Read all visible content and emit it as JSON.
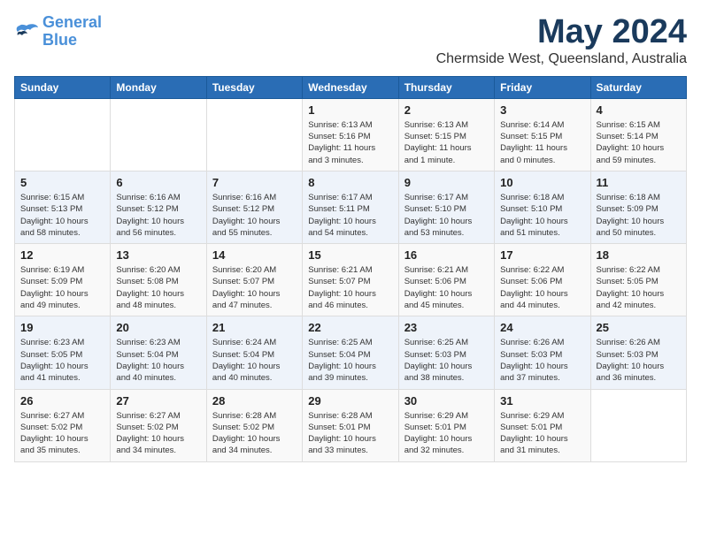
{
  "header": {
    "logo_line1": "General",
    "logo_line2": "Blue",
    "title": "May 2024",
    "subtitle": "Chermside West, Queensland, Australia"
  },
  "days_of_week": [
    "Sunday",
    "Monday",
    "Tuesday",
    "Wednesday",
    "Thursday",
    "Friday",
    "Saturday"
  ],
  "weeks": [
    [
      {
        "day": "",
        "info": ""
      },
      {
        "day": "",
        "info": ""
      },
      {
        "day": "",
        "info": ""
      },
      {
        "day": "1",
        "info": "Sunrise: 6:13 AM\nSunset: 5:16 PM\nDaylight: 11 hours\nand 3 minutes."
      },
      {
        "day": "2",
        "info": "Sunrise: 6:13 AM\nSunset: 5:15 PM\nDaylight: 11 hours\nand 1 minute."
      },
      {
        "day": "3",
        "info": "Sunrise: 6:14 AM\nSunset: 5:15 PM\nDaylight: 11 hours\nand 0 minutes."
      },
      {
        "day": "4",
        "info": "Sunrise: 6:15 AM\nSunset: 5:14 PM\nDaylight: 10 hours\nand 59 minutes."
      }
    ],
    [
      {
        "day": "5",
        "info": "Sunrise: 6:15 AM\nSunset: 5:13 PM\nDaylight: 10 hours\nand 58 minutes."
      },
      {
        "day": "6",
        "info": "Sunrise: 6:16 AM\nSunset: 5:12 PM\nDaylight: 10 hours\nand 56 minutes."
      },
      {
        "day": "7",
        "info": "Sunrise: 6:16 AM\nSunset: 5:12 PM\nDaylight: 10 hours\nand 55 minutes."
      },
      {
        "day": "8",
        "info": "Sunrise: 6:17 AM\nSunset: 5:11 PM\nDaylight: 10 hours\nand 54 minutes."
      },
      {
        "day": "9",
        "info": "Sunrise: 6:17 AM\nSunset: 5:10 PM\nDaylight: 10 hours\nand 53 minutes."
      },
      {
        "day": "10",
        "info": "Sunrise: 6:18 AM\nSunset: 5:10 PM\nDaylight: 10 hours\nand 51 minutes."
      },
      {
        "day": "11",
        "info": "Sunrise: 6:18 AM\nSunset: 5:09 PM\nDaylight: 10 hours\nand 50 minutes."
      }
    ],
    [
      {
        "day": "12",
        "info": "Sunrise: 6:19 AM\nSunset: 5:09 PM\nDaylight: 10 hours\nand 49 minutes."
      },
      {
        "day": "13",
        "info": "Sunrise: 6:20 AM\nSunset: 5:08 PM\nDaylight: 10 hours\nand 48 minutes."
      },
      {
        "day": "14",
        "info": "Sunrise: 6:20 AM\nSunset: 5:07 PM\nDaylight: 10 hours\nand 47 minutes."
      },
      {
        "day": "15",
        "info": "Sunrise: 6:21 AM\nSunset: 5:07 PM\nDaylight: 10 hours\nand 46 minutes."
      },
      {
        "day": "16",
        "info": "Sunrise: 6:21 AM\nSunset: 5:06 PM\nDaylight: 10 hours\nand 45 minutes."
      },
      {
        "day": "17",
        "info": "Sunrise: 6:22 AM\nSunset: 5:06 PM\nDaylight: 10 hours\nand 44 minutes."
      },
      {
        "day": "18",
        "info": "Sunrise: 6:22 AM\nSunset: 5:05 PM\nDaylight: 10 hours\nand 42 minutes."
      }
    ],
    [
      {
        "day": "19",
        "info": "Sunrise: 6:23 AM\nSunset: 5:05 PM\nDaylight: 10 hours\nand 41 minutes."
      },
      {
        "day": "20",
        "info": "Sunrise: 6:23 AM\nSunset: 5:04 PM\nDaylight: 10 hours\nand 40 minutes."
      },
      {
        "day": "21",
        "info": "Sunrise: 6:24 AM\nSunset: 5:04 PM\nDaylight: 10 hours\nand 40 minutes."
      },
      {
        "day": "22",
        "info": "Sunrise: 6:25 AM\nSunset: 5:04 PM\nDaylight: 10 hours\nand 39 minutes."
      },
      {
        "day": "23",
        "info": "Sunrise: 6:25 AM\nSunset: 5:03 PM\nDaylight: 10 hours\nand 38 minutes."
      },
      {
        "day": "24",
        "info": "Sunrise: 6:26 AM\nSunset: 5:03 PM\nDaylight: 10 hours\nand 37 minutes."
      },
      {
        "day": "25",
        "info": "Sunrise: 6:26 AM\nSunset: 5:03 PM\nDaylight: 10 hours\nand 36 minutes."
      }
    ],
    [
      {
        "day": "26",
        "info": "Sunrise: 6:27 AM\nSunset: 5:02 PM\nDaylight: 10 hours\nand 35 minutes."
      },
      {
        "day": "27",
        "info": "Sunrise: 6:27 AM\nSunset: 5:02 PM\nDaylight: 10 hours\nand 34 minutes."
      },
      {
        "day": "28",
        "info": "Sunrise: 6:28 AM\nSunset: 5:02 PM\nDaylight: 10 hours\nand 34 minutes."
      },
      {
        "day": "29",
        "info": "Sunrise: 6:28 AM\nSunset: 5:01 PM\nDaylight: 10 hours\nand 33 minutes."
      },
      {
        "day": "30",
        "info": "Sunrise: 6:29 AM\nSunset: 5:01 PM\nDaylight: 10 hours\nand 32 minutes."
      },
      {
        "day": "31",
        "info": "Sunrise: 6:29 AM\nSunset: 5:01 PM\nDaylight: 10 hours\nand 31 minutes."
      },
      {
        "day": "",
        "info": ""
      }
    ]
  ]
}
